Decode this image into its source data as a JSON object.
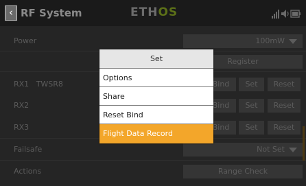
{
  "header": {
    "back_icon": "chevron-left-icon",
    "title": "RF System",
    "logo_main": "ETH",
    "logo_version": "OS",
    "status_icons": [
      "signal-bars-icon",
      "speaker-icon",
      "battery-icon"
    ]
  },
  "rows": {
    "power": {
      "label": "Power",
      "value": "100mW"
    },
    "register": {
      "button": "Register"
    },
    "rx1": {
      "label": "RX1",
      "name": "TWSR8",
      "bind": "Bind",
      "set": "Set",
      "reset": "Reset"
    },
    "rx2": {
      "label": "RX2",
      "bind": "Bind",
      "set": "Set",
      "reset": "Reset"
    },
    "rx3": {
      "label": "RX3",
      "bind": "Bind",
      "set": "Set",
      "reset": "Reset"
    },
    "failsafe": {
      "label": "Failsafe",
      "value": "Not Set"
    },
    "actions": {
      "label": "Actions",
      "button": "Range Check"
    }
  },
  "popup": {
    "title": "Set",
    "items": [
      "Options",
      "Share",
      "Reset Bind",
      "Flight Data Record"
    ],
    "selected_index": 3
  },
  "colors": {
    "accent": "#f3a62a",
    "background": "#252525"
  }
}
